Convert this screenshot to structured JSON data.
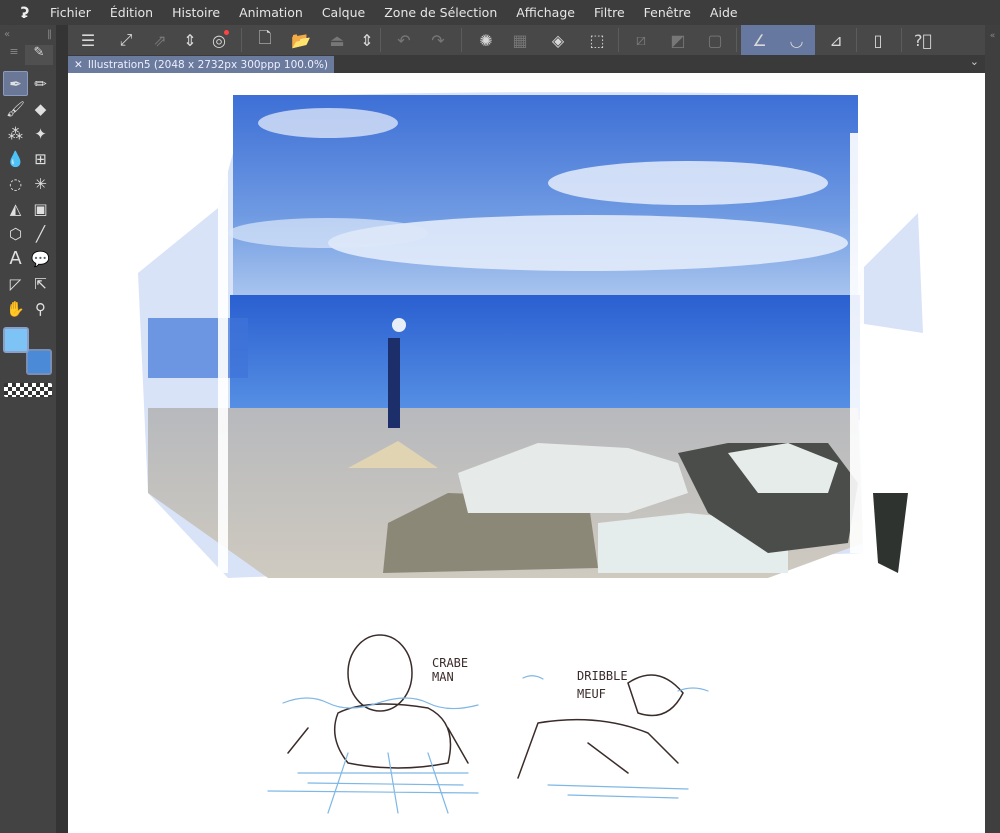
{
  "menu": {
    "logo_icon": "clip-studio-logo-icon",
    "items": [
      "Fichier",
      "Édition",
      "Histoire",
      "Animation",
      "Calque",
      "Zone de Sélection",
      "Affichage",
      "Filtre",
      "Fenêtre",
      "Aide"
    ]
  },
  "toolbar": {
    "icons": [
      "menu-icon",
      "fullscreen-icon",
      "export-icon",
      "up-down-icon",
      "clip-studio-icon",
      "new-file-icon",
      "open-folder-icon",
      "save-icon",
      "up-down-icon",
      "undo-icon",
      "redo-icon",
      "loading-icon",
      "transform-icon",
      "fill-icon",
      "selection-resize-icon",
      "clear-selection-icon",
      "invert-selection-icon",
      "border-icon",
      "ruler-snap-icon",
      "special-ruler-snap-icon",
      "grid-snap-icon",
      "smartphone-icon",
      "help-icon"
    ]
  },
  "tab": {
    "title": "Illustration5 (2048 x 2732px 300ppp 100.0%)"
  },
  "tools": [
    "pen",
    "pencil",
    "brush",
    "eraser",
    "airbrush",
    "sparkle",
    "blend",
    "mesh",
    "lasso",
    "magic-wand",
    "fill",
    "gradient",
    "3d-object",
    "line",
    "text",
    "balloon",
    "ruler",
    "operation",
    "hand",
    "eyedropper"
  ],
  "colors": {
    "foreground": "#7ec3f5",
    "background": "#4a8ad6"
  },
  "sketches": {
    "left_label": [
      "CRABE",
      "MAN"
    ],
    "right_label": [
      "DRIBBLE",
      "MEUF"
    ]
  }
}
